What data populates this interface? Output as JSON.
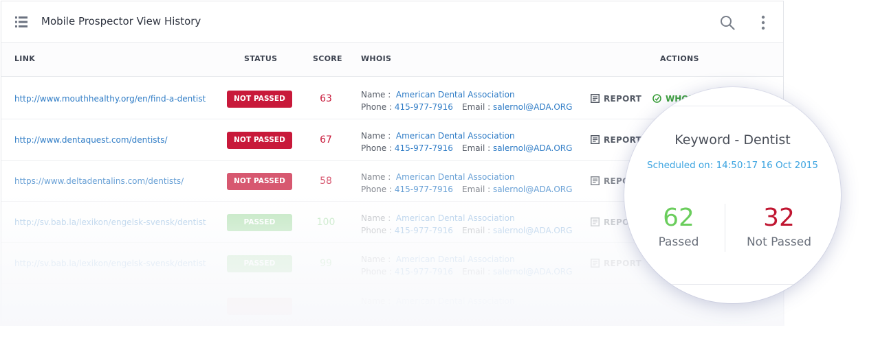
{
  "header": {
    "title": "Mobile Prospector View History"
  },
  "columns": {
    "link": "LINK",
    "status": "STATUS",
    "score": "SCORE",
    "whois": "WHOIS",
    "actions": "ACTIONS"
  },
  "labels": {
    "name": "Name :",
    "phone": "Phone :",
    "email": "Email :",
    "report": "REPORT",
    "whois_action": "WHOIS"
  },
  "rows": [
    {
      "link": "http://www.mouthhealthy.org/en/find-a-dentist",
      "status": "NOT PASSED",
      "score": "63",
      "name": "American Dental Association",
      "phone": "415-977-7916",
      "email": "salernol@ADA.ORG"
    },
    {
      "link": "http://www.dentaquest.com/dentists/",
      "status": "NOT PASSED",
      "score": "67",
      "name": "American Dental Association",
      "phone": "415-977-7916",
      "email": "salernol@ADA.ORG"
    },
    {
      "link": "https://www.deltadentalins.com/dentists/",
      "status": "NOT PASSED",
      "score": "58",
      "name": "American Dental Association",
      "phone": "415-977-7916",
      "email": "salernol@ADA.ORG"
    },
    {
      "link": "http://sv.bab.la/lexikon/engelsk-svensk/dentist",
      "status": "PASSED",
      "score": "100",
      "name": "American Dental Association",
      "phone": "415-977-7916",
      "email": "salernol@ADA.ORG"
    },
    {
      "link": "http://sv.bab.la/lexikon/engelsk-svensk/dentist",
      "status": "PASSED",
      "score": "99",
      "name": "American Dental Association",
      "phone": "415-977-7916",
      "email": "salernol@ADA.ORG"
    },
    {
      "name": "American Dental Association"
    }
  ],
  "summary": {
    "title": "Keyword - Dentist",
    "scheduled": "Scheduled on: 14:50:17 16 Oct 2015",
    "passed_count": "62",
    "passed_label": "Passed",
    "not_passed_count": "32",
    "not_passed_label": "Not Passed"
  },
  "colors": {
    "fail": "#c8193a",
    "pass": "#5fc15d",
    "link": "#2f7cc6",
    "accent": "#3aa3e0"
  }
}
